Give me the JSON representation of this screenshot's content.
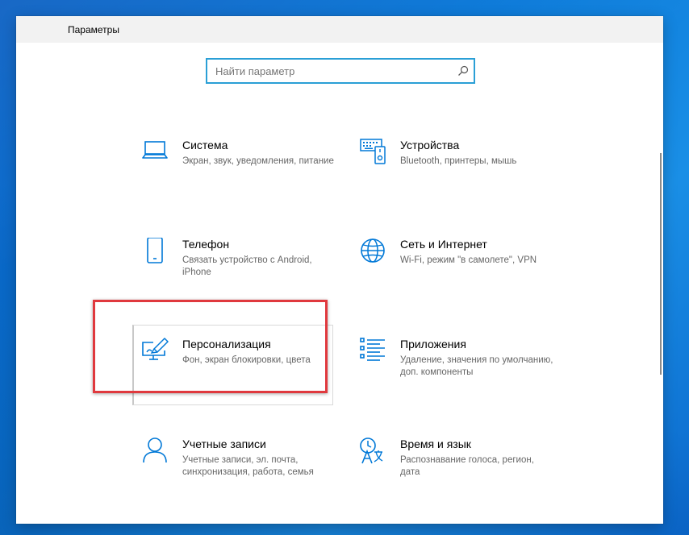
{
  "window": {
    "title": "Параметры"
  },
  "search": {
    "placeholder": "Найти параметр"
  },
  "colors": {
    "accent": "#0078d7",
    "highlight": "#e0393e",
    "desktop": "#0a78d8"
  },
  "categories": [
    {
      "icon": "laptop-icon",
      "title": "Система",
      "desc": "Экран, звук, уведомления, питание"
    },
    {
      "icon": "keyboard-icon",
      "title": "Устройства",
      "desc": "Bluetooth, принтеры, мышь"
    },
    {
      "icon": "phone-icon",
      "title": "Телефон",
      "desc": "Связать устройство с Android, iPhone"
    },
    {
      "icon": "globe-icon",
      "title": "Сеть и Интернет",
      "desc": "Wi-Fi, режим \"в самолете\", VPN"
    },
    {
      "icon": "personalization-icon",
      "title": "Персонализация",
      "desc": "Фон, экран блокировки, цвета"
    },
    {
      "icon": "apps-icon",
      "title": "Приложения",
      "desc": "Удаление, значения по умолчанию, доп. компоненты"
    },
    {
      "icon": "person-icon",
      "title": "Учетные записи",
      "desc": "Учетные записи, эл. почта, синхронизация, работа, семья"
    },
    {
      "icon": "time-language-icon",
      "title": "Время и язык",
      "desc": "Распознавание голоса, регион, дата"
    }
  ]
}
